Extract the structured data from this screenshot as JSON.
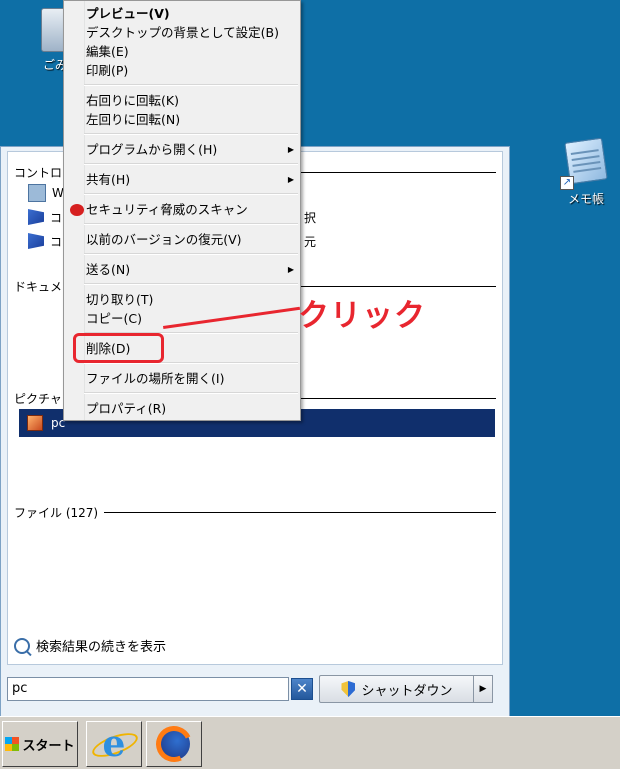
{
  "desktop": {
    "recycle_label": "ごみ",
    "memo_label": "メモ帳",
    "memo_arrow": "↗"
  },
  "context_menu": {
    "items": [
      {
        "label": "プレビュー(V)"
      },
      {
        "label": "デスクトップの背景として設定(B)"
      },
      {
        "label": "編集(E)"
      },
      {
        "label": "印刷(P)"
      },
      {
        "label": "右回りに回転(K)"
      },
      {
        "label": "左回りに回転(N)"
      },
      {
        "label": "プログラムから開く(H)"
      },
      {
        "label": "共有(H)"
      },
      {
        "label": "セキュリティ脅威のスキャン"
      },
      {
        "label": "以前のバージョンの復元(V)"
      },
      {
        "label": "送る(N)"
      },
      {
        "label": "切り取り(T)"
      },
      {
        "label": "コピー(C)"
      },
      {
        "label": "削除(D)"
      },
      {
        "label": "ファイルの場所を開く(I)"
      },
      {
        "label": "プロパティ(R)"
      }
    ],
    "submenu_arrow": "▶"
  },
  "annotation": {
    "text": "クリック"
  },
  "start_menu": {
    "group_control_panel": "コントロー",
    "rows": [
      {
        "label": "W"
      },
      {
        "label": "コ",
        "suffix": "択"
      },
      {
        "label": "コ",
        "suffix": "元"
      }
    ],
    "group_documents": "ドキュメン",
    "group_pictures": "ピクチャ (",
    "selected_item": "pc",
    "group_files": "ファイル (127)",
    "more_results": "検索結果の続きを表示",
    "search_value": "pc",
    "clear_glyph": "✕",
    "shutdown_label": "シャットダウン",
    "shutdown_arrow": "▶"
  },
  "taskbar": {
    "start_label": "スタート",
    "ie_glyph": "e"
  }
}
